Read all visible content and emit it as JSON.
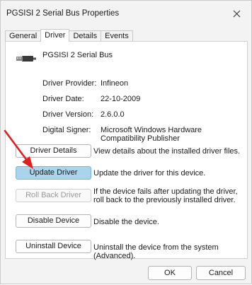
{
  "window": {
    "title": "PGSISI 2 Serial Bus Properties"
  },
  "tabs": [
    {
      "label": "General"
    },
    {
      "label": "Driver"
    },
    {
      "label": "Details"
    },
    {
      "label": "Events"
    }
  ],
  "device": {
    "name": "PGSISI 2 Serial Bus",
    "icon": "usb-plug-icon"
  },
  "info": [
    {
      "label": "Driver Provider:",
      "value": "Infineon"
    },
    {
      "label": "Driver Date:",
      "value": "22-10-2009"
    },
    {
      "label": "Driver Version:",
      "value": "2.6.0.0"
    },
    {
      "label": "Digital Signer:",
      "value": "Microsoft Windows Hardware Compatibility Publisher"
    }
  ],
  "actions": [
    {
      "label": "Driver Details",
      "description": "View details about the installed driver files."
    },
    {
      "label": "Update Driver",
      "description": "Update the driver for this device."
    },
    {
      "label": "Roll Back Driver",
      "description": "If the device fails after updating the driver, roll back to the previously installed driver."
    },
    {
      "label": "Disable Device",
      "description": "Disable the device."
    },
    {
      "label": "Uninstall Device",
      "description": "Uninstall the device from the system (Advanced)."
    }
  ],
  "footer": {
    "ok": "OK",
    "cancel": "Cancel"
  },
  "colors": {
    "accent": "#a9d4ec",
    "annotation_arrow": "#e02020"
  }
}
